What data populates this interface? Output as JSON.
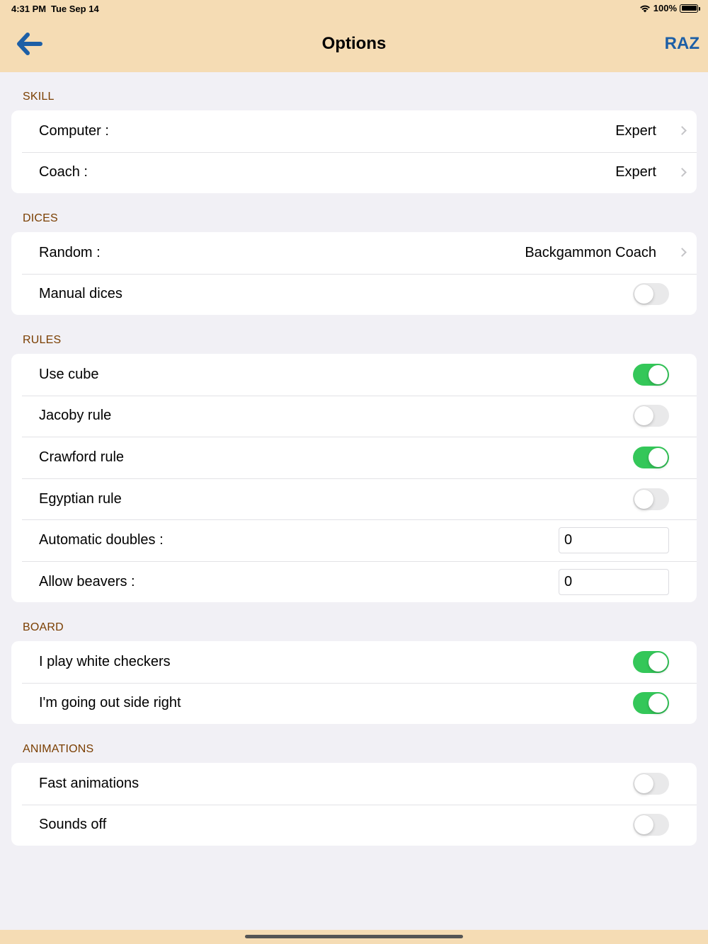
{
  "status": {
    "time": "4:31 PM",
    "date": "Tue Sep 14",
    "battery": "100%"
  },
  "nav": {
    "title": "Options",
    "right_button": "RAZ",
    "back_icon": "arrow-left-icon"
  },
  "colors": {
    "header_bg": "#f5dcb4",
    "accent": "#1d5fa6",
    "section_header": "#7a3e00",
    "toggle_on": "#34c759"
  },
  "sections": {
    "skill": {
      "header": "SKILL",
      "computer": {
        "label": "Computer :",
        "value": "Expert"
      },
      "coach": {
        "label": "Coach :",
        "value": "Expert"
      }
    },
    "dices": {
      "header": "DICES",
      "random": {
        "label": "Random :",
        "value": "Backgammon Coach"
      },
      "manual": {
        "label": "Manual dices",
        "on": false
      }
    },
    "rules": {
      "header": "RULES",
      "use_cube": {
        "label": "Use cube",
        "on": true
      },
      "jacoby": {
        "label": "Jacoby rule",
        "on": false
      },
      "crawford": {
        "label": "Crawford rule",
        "on": true
      },
      "egyptian": {
        "label": "Egyptian rule",
        "on": false
      },
      "auto_doubles": {
        "label": "Automatic doubles :",
        "value": "0"
      },
      "beavers": {
        "label": "Allow beavers :",
        "value": "0"
      }
    },
    "board": {
      "header": "BOARD",
      "white": {
        "label": "I play white checkers",
        "on": true
      },
      "side_right": {
        "label": "I'm going out side right",
        "on": true
      }
    },
    "animations": {
      "header": "ANIMATIONS",
      "fast": {
        "label": "Fast animations",
        "on": false
      },
      "sounds_off": {
        "label": "Sounds off",
        "on": false
      }
    }
  }
}
